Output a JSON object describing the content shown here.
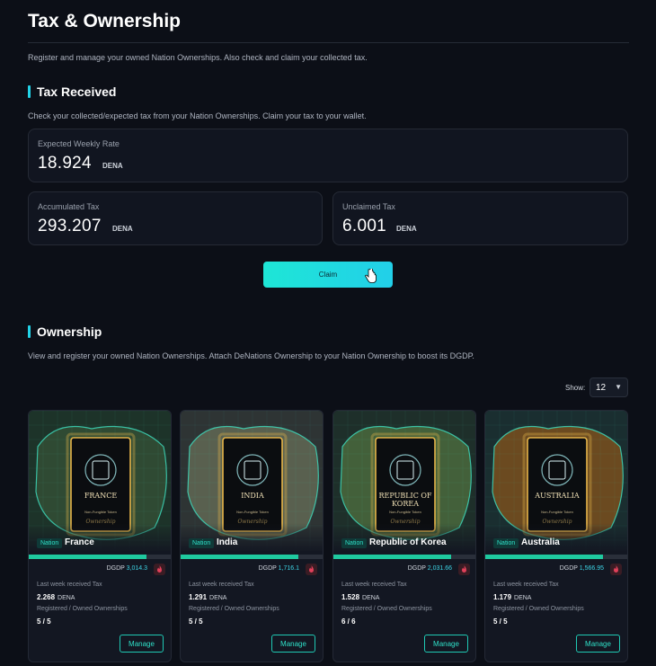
{
  "page": {
    "title": "Tax & Ownership",
    "description": "Register and manage your owned Nation Ownerships. Also check and claim your collected tax."
  },
  "tax": {
    "title": "Tax Received",
    "description": "Check your collected/expected tax from your Nation Ownerships. Claim your tax to your wallet.",
    "expected": {
      "label": "Expected Weekly Rate",
      "value": "18.924",
      "unit": "DENA"
    },
    "accumulated": {
      "label": "Accumulated Tax",
      "value": "293.207",
      "unit": "DENA"
    },
    "unclaimed": {
      "label": "Unclaimed Tax",
      "value": "6.001",
      "unit": "DENA"
    },
    "claim_label": "Claim"
  },
  "ownership": {
    "title": "Ownership",
    "description": "View and register your owned Nation Ownerships. Attach DeNations Ownership to your Nation Ownership to boost its DGDP.",
    "show_label": "Show:",
    "show_value": "12",
    "cards": [
      {
        "badge": "Nation",
        "name": "France",
        "emblem_name": "FRANCE",
        "nft_label": "Non-Fungible Token",
        "script": "Ownership",
        "dgdp_label": "DGDP",
        "dgdp": "3,014.3",
        "progress": 0.82,
        "tax_label": "Last week received Tax",
        "tax_value": "2.268",
        "tax_unit": "DENA",
        "reg_label": "Registered / Owned Ownerships",
        "reg_value": "5 / 5",
        "manage_label": "Manage",
        "bg": "#1d3329",
        "land": "#2f4a33"
      },
      {
        "badge": "Nation",
        "name": "India",
        "emblem_name": "INDIA",
        "nft_label": "Non-Fungible Token",
        "script": "Ownership",
        "dgdp_label": "DGDP",
        "dgdp": "1,716.1",
        "progress": 0.82,
        "tax_label": "Last week received Tax",
        "tax_value": "1.291",
        "tax_unit": "DENA",
        "reg_label": "Registered / Owned Ownerships",
        "reg_value": "5 / 5",
        "manage_label": "Manage",
        "bg": "#2e3434",
        "land": "#59604f"
      },
      {
        "badge": "Nation",
        "name": "Republic of Korea",
        "emblem_name": "REPUBLIC OF KOREA",
        "nft_label": "Non-Fungible Token",
        "script": "Ownership",
        "dgdp_label": "DGDP",
        "dgdp": "2,031.66",
        "progress": 0.82,
        "tax_label": "Last week received Tax",
        "tax_value": "1.528",
        "tax_unit": "DENA",
        "reg_label": "Registered / Owned Ownerships",
        "reg_value": "6 / 6",
        "manage_label": "Manage",
        "bg": "#1e2f2a",
        "land": "#43603a"
      },
      {
        "badge": "Nation",
        "name": "Australia",
        "emblem_name": "AUSTRALIA",
        "nft_label": "Non-Fungible Token",
        "script": "Ownership",
        "dgdp_label": "DGDP",
        "dgdp": "1,566.95",
        "progress": 0.82,
        "tax_label": "Last week received Tax",
        "tax_value": "1.179",
        "tax_unit": "DENA",
        "reg_label": "Registered / Owned Ownerships",
        "reg_value": "5 / 5",
        "manage_label": "Manage",
        "bg": "#1a2e30",
        "land": "#6b4a20"
      }
    ]
  },
  "colors": {
    "accent": "#22d3e8",
    "green": "#1fc99f",
    "gold": "#e8b64a"
  }
}
